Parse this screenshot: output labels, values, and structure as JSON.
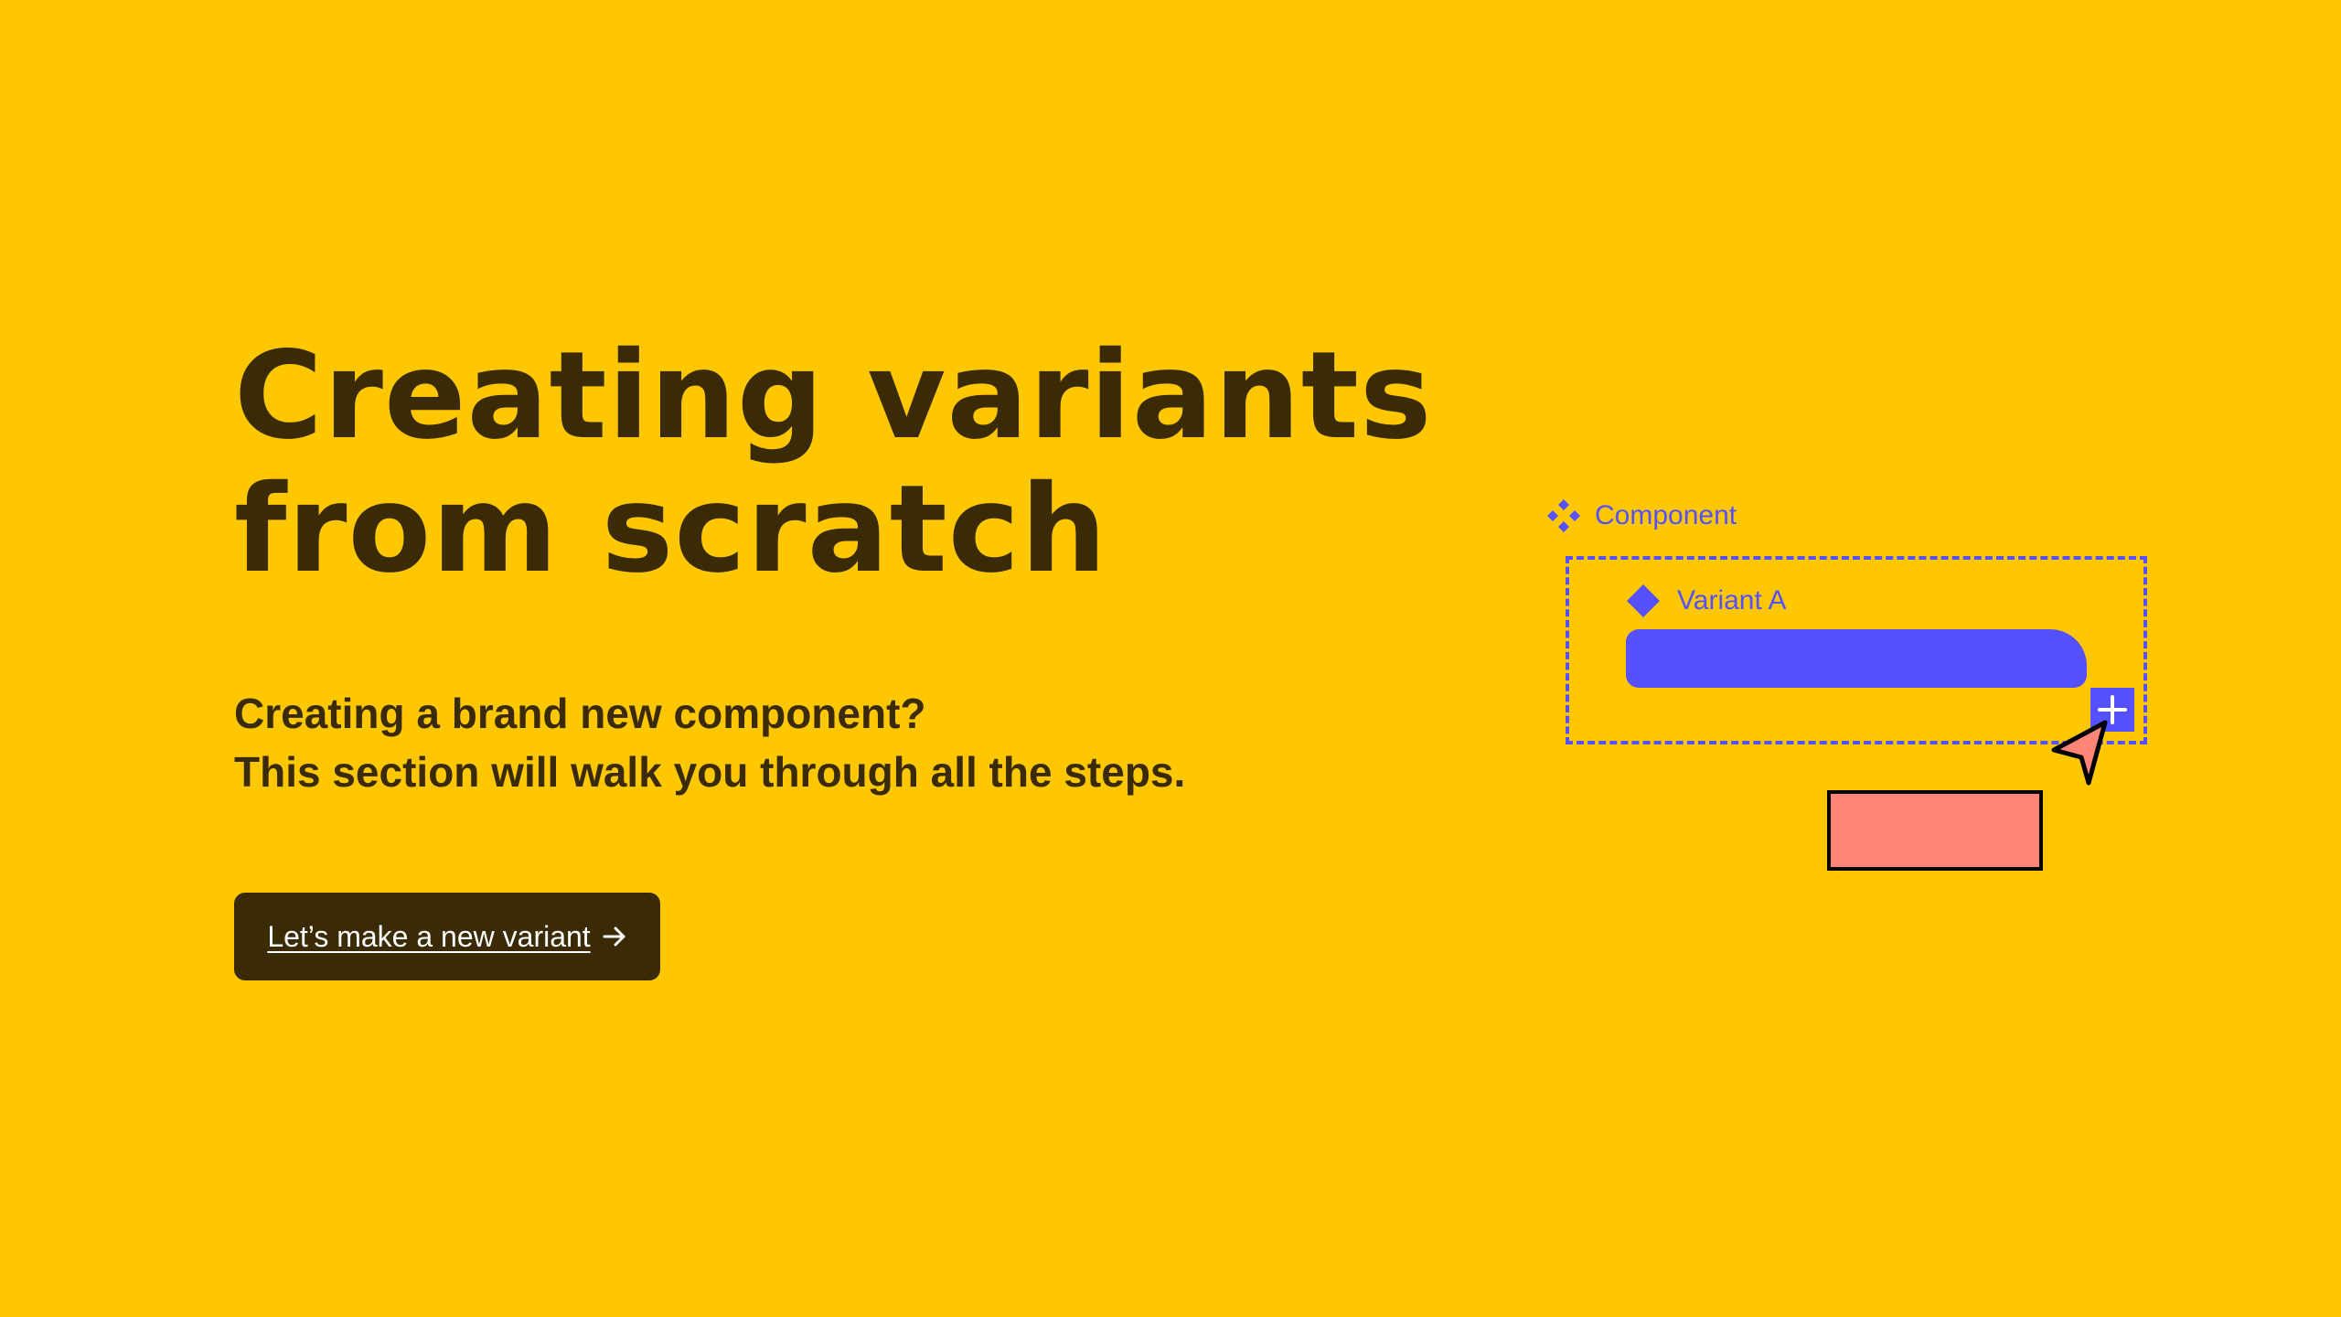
{
  "hero": {
    "title_line1": "Creating variants",
    "title_line2": "from scratch",
    "subtitle_line1": "Creating a brand new component?",
    "subtitle_line2": "This section will walk you through all the steps.",
    "cta_label": "Let’s make a new variant"
  },
  "illustration": {
    "component_label": "Component",
    "variant_label": "Variant A"
  },
  "icons": {
    "component": "component-icon",
    "variant": "variant-diamond-icon",
    "plus": "plus-icon",
    "cursor": "cursor-arrow-icon",
    "arrow": "arrow-right-icon"
  },
  "colors": {
    "background": "#FFC700",
    "text": "#3A2B05",
    "accent": "#5551FF",
    "pink": "#FF8577",
    "button_bg": "#3A2B05",
    "button_text": "#FFFFFF"
  }
}
